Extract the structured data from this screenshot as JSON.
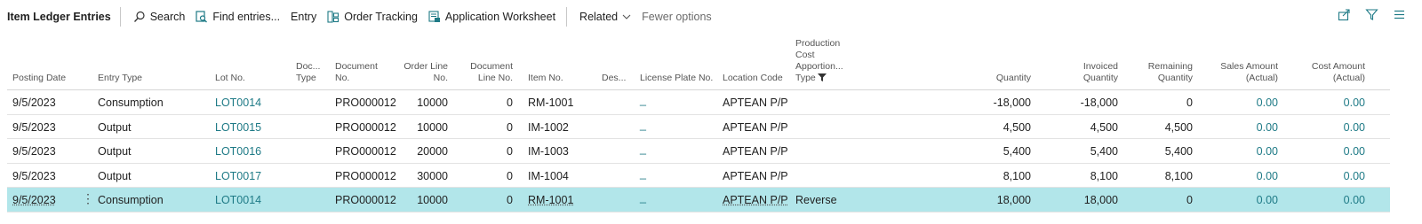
{
  "toolbar": {
    "title": "Item Ledger Entries",
    "search": "Search",
    "find_entries": "Find entries...",
    "entry": "Entry",
    "order_tracking": "Order Tracking",
    "application_worksheet": "Application Worksheet",
    "related": "Related",
    "fewer_options": "Fewer options"
  },
  "columns": {
    "posting_date": "Posting Date",
    "entry_type": "Entry Type",
    "lot_no": "Lot No.",
    "doc_type_1": "Doc...",
    "doc_type_2": "Type",
    "document_no_1": "Document",
    "document_no_2": "No.",
    "order_line_no_1": "Order Line",
    "order_line_no_2": "No.",
    "document_line_no_1": "Document",
    "document_line_no_2": "Line No.",
    "item_no": "Item No.",
    "description": "Des...",
    "license_plate_no": "License Plate No.",
    "location_code": "Location Code",
    "prod_cost_1": "Production",
    "prod_cost_2": "Cost",
    "prod_cost_3": "Apportion...",
    "prod_cost_4": "Type",
    "quantity": "Quantity",
    "invoiced_quantity_1": "Invoiced",
    "invoiced_quantity_2": "Quantity",
    "remaining_quantity_1": "Remaining",
    "remaining_quantity_2": "Quantity",
    "sales_amount_1": "Sales Amount",
    "sales_amount_2": "(Actual)",
    "cost_amount_1": "Cost Amount",
    "cost_amount_2": "(Actual)"
  },
  "rows": [
    {
      "posting_date": "9/5/2023",
      "entry_type": "Consumption",
      "lot_no": "LOT0014",
      "document_no": "PRO000012",
      "order_line_no": "10000",
      "document_line_no": "0",
      "item_no": "RM-1001",
      "license_plate": "_",
      "location_code": "APTEAN P/P",
      "prod_cost_type": "",
      "quantity": "-18,000",
      "invoiced_quantity": "-18,000",
      "remaining_quantity": "0",
      "sales_amount": "0.00",
      "cost_amount": "0.00"
    },
    {
      "posting_date": "9/5/2023",
      "entry_type": "Output",
      "lot_no": "LOT0015",
      "document_no": "PRO000012",
      "order_line_no": "10000",
      "document_line_no": "0",
      "item_no": "IM-1002",
      "license_plate": "_",
      "location_code": "APTEAN P/P",
      "prod_cost_type": "",
      "quantity": "4,500",
      "invoiced_quantity": "4,500",
      "remaining_quantity": "4,500",
      "sales_amount": "0.00",
      "cost_amount": "0.00"
    },
    {
      "posting_date": "9/5/2023",
      "entry_type": "Output",
      "lot_no": "LOT0016",
      "document_no": "PRO000012",
      "order_line_no": "20000",
      "document_line_no": "0",
      "item_no": "IM-1003",
      "license_plate": "_",
      "location_code": "APTEAN P/P",
      "prod_cost_type": "",
      "quantity": "5,400",
      "invoiced_quantity": "5,400",
      "remaining_quantity": "5,400",
      "sales_amount": "0.00",
      "cost_amount": "0.00"
    },
    {
      "posting_date": "9/5/2023",
      "entry_type": "Output",
      "lot_no": "LOT0017",
      "document_no": "PRO000012",
      "order_line_no": "30000",
      "document_line_no": "0",
      "item_no": "IM-1004",
      "license_plate": "_",
      "location_code": "APTEAN P/P",
      "prod_cost_type": "",
      "quantity": "8,100",
      "invoiced_quantity": "8,100",
      "remaining_quantity": "8,100",
      "sales_amount": "0.00",
      "cost_amount": "0.00"
    },
    {
      "posting_date": "9/5/2023",
      "entry_type": "Consumption",
      "lot_no": "LOT0014",
      "document_no": "PRO000012",
      "order_line_no": "10000",
      "document_line_no": "0",
      "item_no": "RM-1001",
      "license_plate": "_",
      "location_code": "APTEAN P/P",
      "prod_cost_type": "Reverse",
      "quantity": "18,000",
      "invoiced_quantity": "18,000",
      "remaining_quantity": "0",
      "sales_amount": "0.00",
      "cost_amount": "0.00"
    }
  ],
  "selected_row_index": 4,
  "colors": {
    "accent": "#1e7a86",
    "selected_row": "#b2e6ea"
  }
}
